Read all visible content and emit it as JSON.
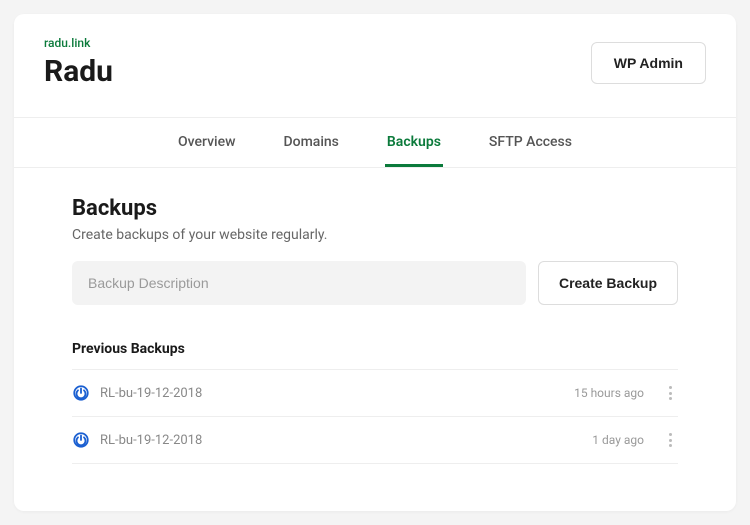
{
  "header": {
    "domain": "radu.link",
    "site_name": "Radu",
    "wp_admin": "WP Admin"
  },
  "tabs": {
    "overview": "Overview",
    "domains": "Domains",
    "backups": "Backups",
    "sftp": "SFTP Access"
  },
  "backups": {
    "title": "Backups",
    "subtitle": "Create backups of your website regularly.",
    "description_placeholder": "Backup Description",
    "create_button": "Create Backup",
    "previous_title": "Previous Backups",
    "items": [
      {
        "name": "RL-bu-19-12-2018",
        "time": "15 hours ago"
      },
      {
        "name": "RL-bu-19-12-2018",
        "time": "1 day ago"
      }
    ]
  },
  "colors": {
    "brand": "#0b7a3b",
    "icon_ring": "#1a5fd1"
  }
}
